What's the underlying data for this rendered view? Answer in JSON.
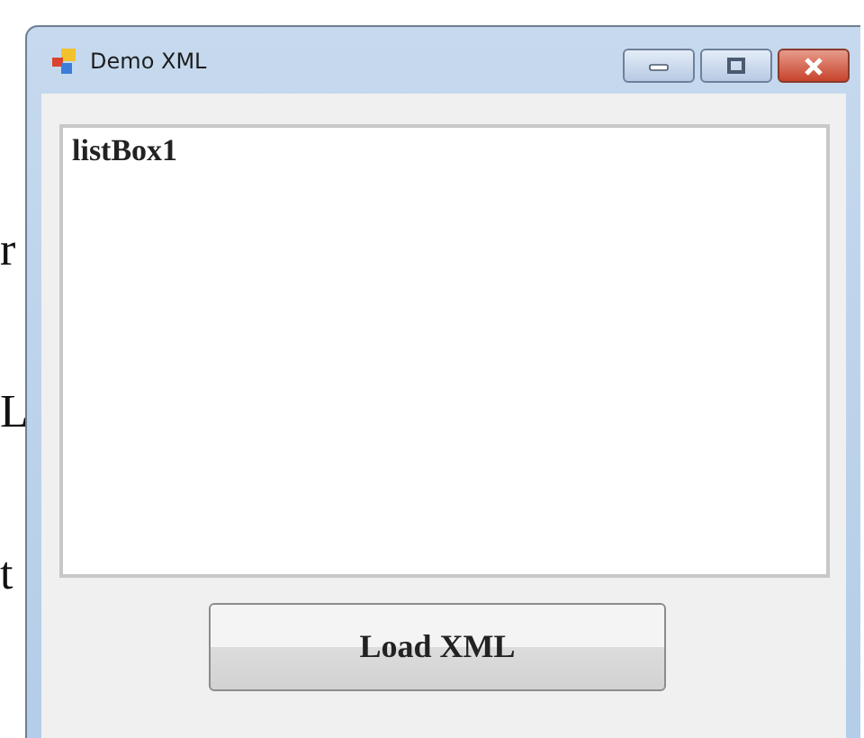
{
  "document_fragments": [
    "r",
    "L",
    "t"
  ],
  "window": {
    "title": "Demo XML"
  },
  "list_box": {
    "items": [
      "listBox1"
    ]
  },
  "button": {
    "label": "Load XML"
  }
}
